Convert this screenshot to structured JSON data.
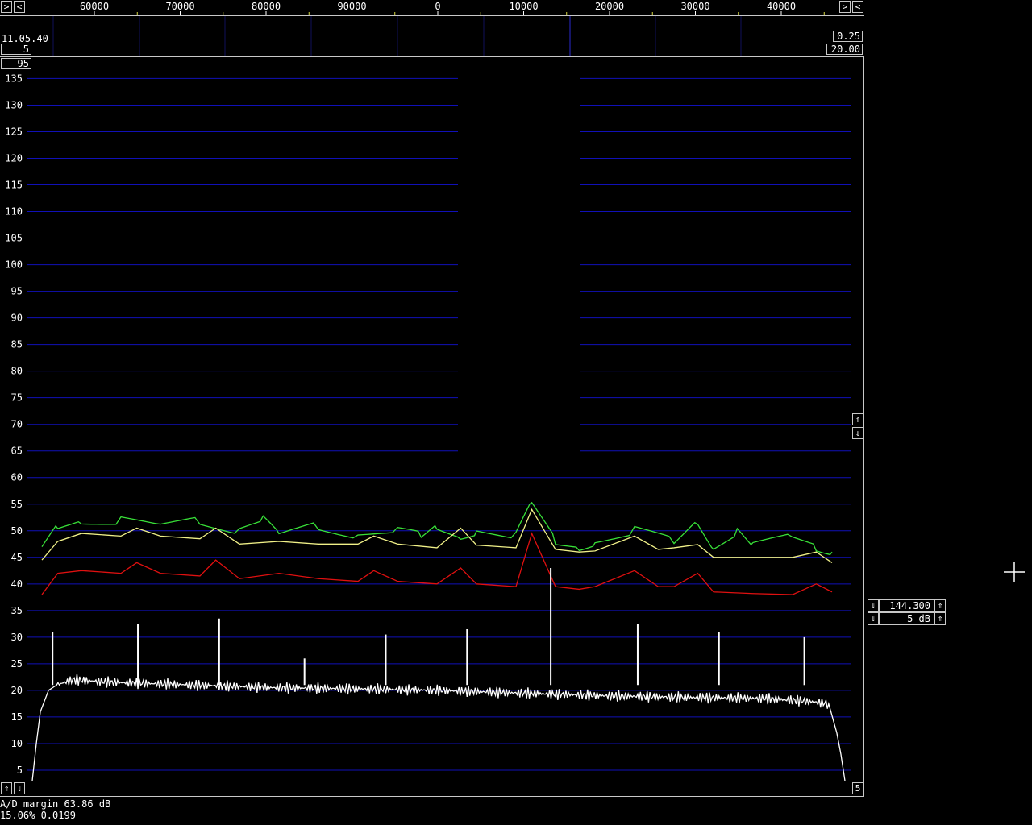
{
  "top_scale": {
    "labels": [
      "60000",
      "70000",
      "80000",
      "90000",
      "0",
      "10000",
      "20000",
      "30000",
      "40000"
    ],
    "left_buttons": [
      ">",
      "<"
    ],
    "right_buttons": [
      ">",
      "<"
    ]
  },
  "waterfall": {
    "time": "11.05.40",
    "avg_count": "5",
    "right_value_1": "0.25",
    "right_value_2": "20.00"
  },
  "spectrum": {
    "top_box": "95",
    "y_ticks": [
      "135",
      "130",
      "125",
      "120",
      "115",
      "110",
      "105",
      "100",
      "95",
      "90",
      "85",
      "80",
      "75",
      "70",
      "65",
      "60",
      "55",
      "50",
      "45",
      "40",
      "35",
      "30",
      "25",
      "20",
      "15",
      "10",
      "5"
    ],
    "ymin": 0,
    "ymax": 139,
    "bottom_right_box": "5",
    "colors": {
      "grid": "#1010b8",
      "green": "#38e038",
      "yellow": "#f0f088",
      "red": "#e01010",
      "white": "#ffffff"
    }
  },
  "side_controls": {
    "up_arrow": "⇑",
    "down_arrow": "⇓"
  },
  "freq_box": {
    "frequency": "144.300",
    "gain": "5 dB"
  },
  "status": {
    "ad_margin": "A/D margin 63.86 dB",
    "percent": "15.06% 0.0199"
  },
  "chart_data": {
    "type": "line",
    "title": "",
    "xlabel": "",
    "ylabel": "",
    "ylim": [
      0,
      139
    ],
    "series": [
      {
        "color": "green",
        "x": [
          0,
          2,
          5,
          10,
          15,
          20,
          25,
          28,
          30,
          35,
          40,
          45,
          48,
          50,
          53,
          55,
          60,
          62,
          65,
          68,
          70,
          75,
          80,
          83,
          85,
          88,
          90,
          95,
          98,
          100
        ],
        "values": [
          47,
          51,
          52,
          52,
          51,
          52,
          50,
          52,
          49,
          51,
          49,
          50,
          49,
          51,
          49,
          50,
          49,
          55,
          48,
          47,
          48,
          50,
          48,
          52,
          47,
          50,
          47,
          49,
          47,
          46
        ]
      },
      {
        "color": "yellow",
        "x": [
          0,
          2,
          5,
          10,
          12,
          15,
          20,
          22,
          25,
          30,
          35,
          40,
          42,
          45,
          50,
          53,
          55,
          60,
          62,
          65,
          68,
          70,
          75,
          78,
          80,
          83,
          85,
          90,
          95,
          98,
          100
        ],
        "values": [
          44.5,
          48,
          49.5,
          49,
          50.5,
          49,
          48.5,
          50.5,
          47.5,
          48,
          47.5,
          47.5,
          49,
          47.5,
          46.8,
          50.5,
          47.3,
          46.8,
          54,
          46.5,
          46,
          46.2,
          49,
          46.5,
          46.8,
          47.4,
          45,
          45,
          45,
          46,
          44
        ]
      },
      {
        "color": "red",
        "x": [
          0,
          2,
          5,
          10,
          12,
          15,
          20,
          22,
          25,
          30,
          35,
          40,
          42,
          45,
          50,
          53,
          55,
          60,
          62,
          65,
          68,
          70,
          75,
          78,
          80,
          83,
          85,
          90,
          95,
          98,
          100
        ],
        "values": [
          38,
          42,
          42.5,
          42,
          44,
          42,
          41.5,
          44.5,
          41,
          42,
          41,
          40.5,
          42.5,
          40.5,
          40,
          43,
          40,
          39.5,
          49.5,
          39.5,
          39,
          39.5,
          42.5,
          39.5,
          39.5,
          42,
          38.5,
          38.2,
          38,
          40,
          38.5
        ]
      },
      {
        "color": "white",
        "x": [
          0,
          0.5,
          1,
          2,
          3,
          5,
          10,
          20,
          30,
          40,
          50,
          60,
          70,
          80,
          90,
          95,
          98,
          99,
          99.5,
          100
        ],
        "values": [
          3,
          10,
          16,
          20,
          21,
          22,
          21.5,
          21,
          20.5,
          20.3,
          20,
          19.5,
          19,
          18.7,
          18.5,
          18,
          17.5,
          12,
          8,
          3
        ],
        "peaks_x": [
          2.5,
          13,
          23,
          33.5,
          43.5,
          53.5,
          63.8,
          74.5,
          84.5,
          95
        ],
        "peaks_values": [
          31,
          32.5,
          33.5,
          26,
          30.5,
          31.5,
          43,
          32.5,
          31,
          30
        ]
      }
    ]
  }
}
